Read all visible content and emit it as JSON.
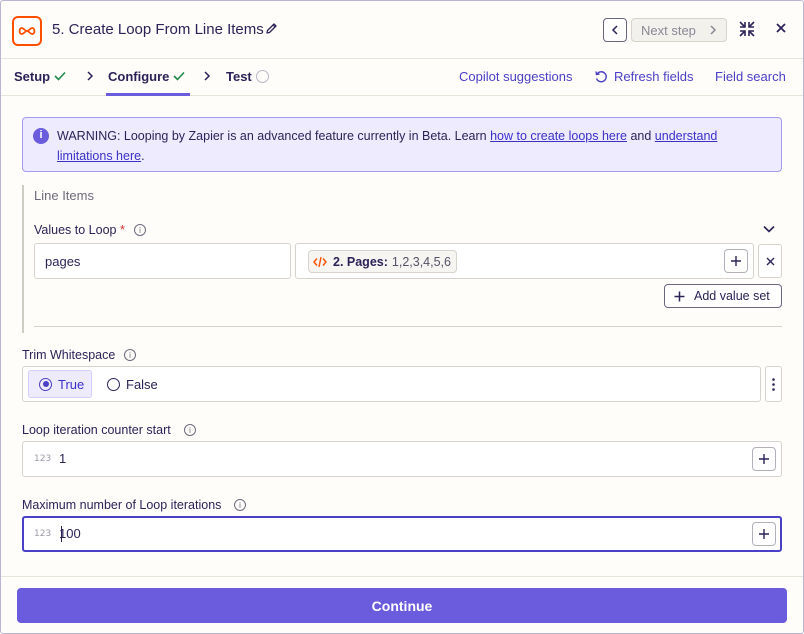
{
  "header": {
    "title": "5. Create Loop From Line Items",
    "next_step_label": "Next step"
  },
  "tabs": {
    "setup": "Setup",
    "configure": "Configure",
    "test": "Test",
    "copilot": "Copilot suggestions",
    "refresh": "Refresh fields",
    "field_search": "Field search"
  },
  "warning": {
    "text_before": "WARNING: Looping by Zapier is an advanced feature currently in Beta. Learn ",
    "link1": "how to create loops here",
    "text_middle": " and ",
    "link2": "understand limitations here",
    "text_after": "."
  },
  "line_items": {
    "title": "Line Items",
    "values_label": "Values to Loop",
    "required_mark": "*",
    "key_value": "pages",
    "pill_step": "2. Pages:",
    "pill_value": "1,2,3,4,5,6",
    "add_value_set": "Add value set"
  },
  "trim": {
    "label": "Trim Whitespace",
    "option_true": "True",
    "option_false": "False",
    "selected": "True"
  },
  "counter_start": {
    "label": "Loop iteration counter start",
    "badge": "123",
    "value": "1"
  },
  "max_iterations": {
    "label": "Maximum number of Loop iterations",
    "badge": "123",
    "value": "100"
  },
  "footer": {
    "continue_label": "Continue"
  },
  "colors": {
    "accent": "#6b5cde",
    "brand_orange": "#ff4f00",
    "success_check": "#1f8a4c",
    "warning_bg": "#eeebff"
  }
}
